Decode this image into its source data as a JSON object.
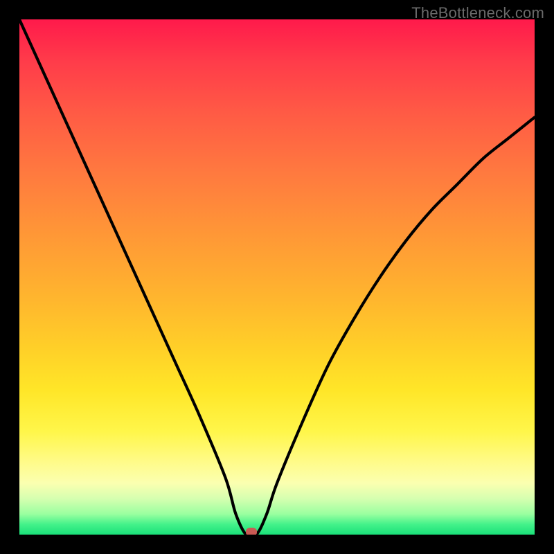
{
  "watermark": "TheBottleneck.com",
  "chart_data": {
    "type": "line",
    "title": "",
    "xlabel": "",
    "ylabel": "",
    "xlim": [
      0,
      100
    ],
    "ylim": [
      0,
      100
    ],
    "x": [
      0,
      5,
      10,
      15,
      20,
      25,
      30,
      35,
      40,
      42,
      44,
      46,
      48,
      50,
      55,
      60,
      65,
      70,
      75,
      80,
      85,
      90,
      95,
      100
    ],
    "values": [
      100,
      89,
      78,
      67,
      56,
      45,
      34,
      23,
      11,
      4,
      0,
      0,
      4,
      10,
      22,
      33,
      42,
      50,
      57,
      63,
      68,
      73,
      77,
      81
    ],
    "series": [
      {
        "name": "bottleneck-curve",
        "color": "#000000"
      }
    ],
    "minimum_point": {
      "x": 45,
      "y": 0
    },
    "grid": false,
    "legend": false
  },
  "colors": {
    "frame": "#000000",
    "curve": "#000000",
    "marker": "#c85a54",
    "watermark": "#6a6a6a"
  }
}
